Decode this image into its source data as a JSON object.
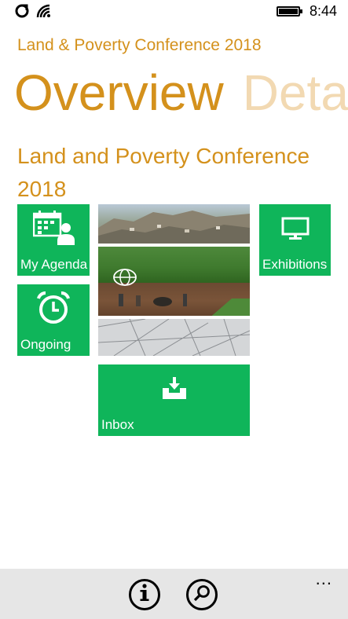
{
  "status_bar": {
    "time": "8:44",
    "icons": [
      "sync-icon",
      "wifi-icon",
      "battery-icon"
    ]
  },
  "app": {
    "title": "Land & Poverty Conference 2018"
  },
  "pivot": {
    "items": [
      {
        "label": "Overview",
        "active": true
      },
      {
        "label": "Deta",
        "active": false
      }
    ]
  },
  "section": {
    "heading": "Land and Poverty Conference 2018"
  },
  "tiles": {
    "my_agenda": {
      "label": "My Agenda",
      "icon": "calendar-person-icon"
    },
    "ongoing": {
      "label": "Ongoing",
      "icon": "alarm-clock-icon"
    },
    "exhibitions": {
      "label": "Exhibitions",
      "icon": "monitor-icon"
    },
    "inbox": {
      "label": "Inbox",
      "icon": "inbox-download-icon"
    },
    "photo": {
      "icon": "globe-icon"
    }
  },
  "colors": {
    "accent": "#d4911c",
    "accent_faded": "#f2d9b2",
    "tile": "#0fb55a",
    "appbar": "#e6e6e6"
  },
  "app_bar": {
    "buttons": [
      "info-icon",
      "search-icon"
    ],
    "more": "..."
  }
}
